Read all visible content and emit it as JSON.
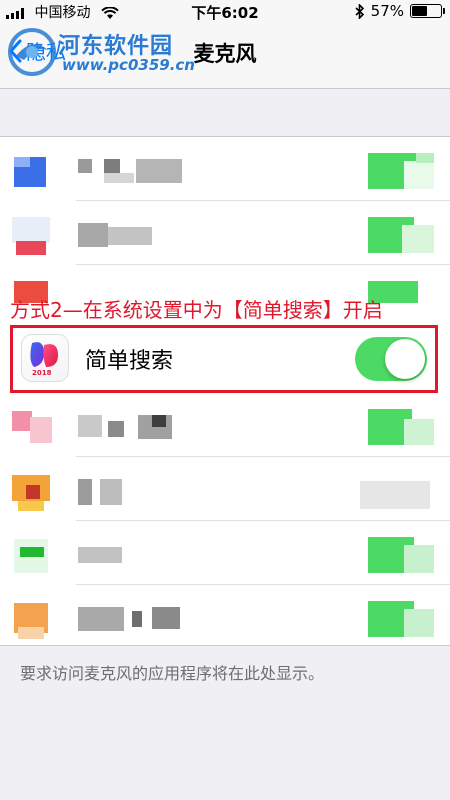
{
  "status_bar": {
    "carrier": "中国移动",
    "time": "下午6:02",
    "battery_percent": "57%",
    "battery_level": 0.57
  },
  "nav": {
    "back_label": "隐私",
    "title": "麦克风"
  },
  "watermark": {
    "site_name": "河东软件园",
    "url": "www.pc0359.cn"
  },
  "annotation": {
    "caption": "方式2—在系统设置中为【简单搜索】开启"
  },
  "highlighted_app": {
    "name": "简单搜索",
    "icon_badge": "2018",
    "microphone_enabled": true
  },
  "footer": {
    "note": "要求访问麦克风的应用程序将在此处显示。"
  },
  "colors": {
    "accent_blue": "#007aff",
    "toggle_on": "#4cd964",
    "highlight_red": "#e0182d"
  }
}
